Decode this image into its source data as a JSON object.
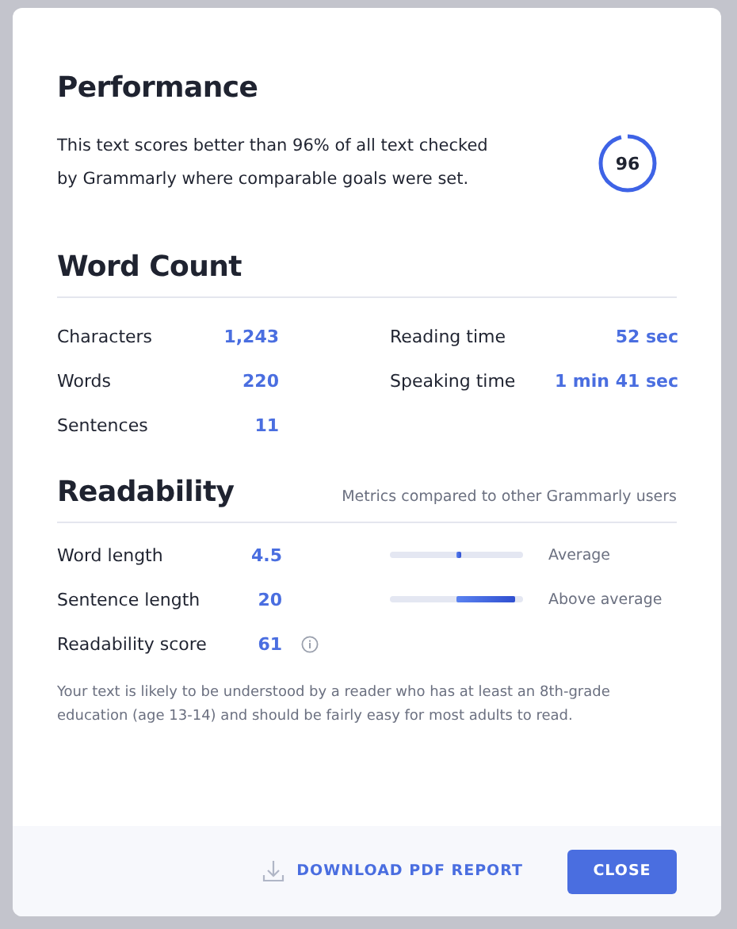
{
  "performance": {
    "title": "Performance",
    "text": "This text scores better than 96% of all text checked by Grammarly where comparable goals were set.",
    "score": "96",
    "level": 0.96
  },
  "word_count": {
    "title": "Word Count",
    "stats": [
      {
        "label": "Characters",
        "value": "1,243"
      },
      {
        "label": "Reading time",
        "value": "52 sec"
      },
      {
        "label": "Words",
        "value": "220"
      },
      {
        "label": "Speaking time",
        "value": "1 min 41 sec"
      },
      {
        "label": "Sentences",
        "value": "11"
      }
    ]
  },
  "readability": {
    "title": "Readability",
    "subtitle": "Metrics compared to other Grammarly users",
    "metrics": [
      {
        "kind": "bar",
        "label": "Word length",
        "value": "4.5",
        "level": 0.53,
        "reading": "Average"
      },
      {
        "kind": "bar",
        "label": "Sentence length",
        "value": "20",
        "level": 0.94,
        "reading": "Above average"
      },
      {
        "kind": "info",
        "label": "Readability score",
        "value": "61"
      }
    ],
    "note": "Your text is likely to be understood by a reader who has at least an 8th-grade education (age 13-14) and should be fairly easy for most adults to read."
  },
  "footer": {
    "download": "DOWNLOAD PDF REPORT",
    "close": "CLOSE"
  }
}
